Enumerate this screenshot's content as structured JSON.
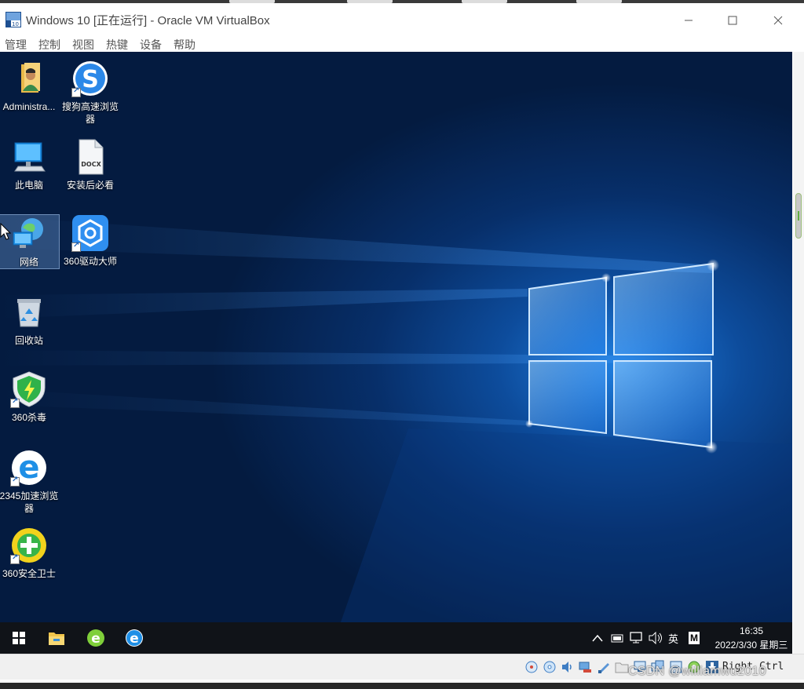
{
  "window": {
    "title": "Windows 10 [正在运行] - Oracle VM VirtualBox",
    "minimize_label": "—",
    "maximize_label": "☐",
    "close_label": "✕"
  },
  "menubar": {
    "items": [
      {
        "label": "管理"
      },
      {
        "label": "控制"
      },
      {
        "label": "视图"
      },
      {
        "label": "热键"
      },
      {
        "label": "设备"
      },
      {
        "label": "帮助"
      }
    ]
  },
  "desktop": {
    "icons": [
      {
        "label": "Administra...",
        "icon": "user-folder-icon"
      },
      {
        "label": "搜狗高速浏览器",
        "icon": "sogou-browser-icon"
      },
      {
        "label": "此电脑",
        "icon": "computer-icon"
      },
      {
        "label": "安装后必看",
        "icon": "docx-file-icon",
        "file_tag": "DOCX"
      },
      {
        "label": "网络",
        "icon": "network-icon"
      },
      {
        "label": "360驱动大师",
        "icon": "driver-master-icon"
      },
      {
        "label": "回收站",
        "icon": "recycle-bin-icon"
      },
      {
        "label": "360杀毒",
        "icon": "antivirus-shield-icon"
      },
      {
        "label": "2345加速浏览器",
        "icon": "ie-browser-icon"
      },
      {
        "label": "360安全卫士",
        "icon": "security-guard-icon"
      }
    ]
  },
  "taskbar": {
    "tray_language": "英",
    "tray_ime": "M",
    "time": "16:35",
    "date": "2022/3/30 星期三"
  },
  "statusbar": {
    "host_key": "Right Ctrl",
    "watermark": "CSDN @williamwu2010"
  },
  "colors": {
    "desktop_blue": "#0d4c9c",
    "taskbar": "#101318",
    "accent_green": "#5fae3f"
  }
}
